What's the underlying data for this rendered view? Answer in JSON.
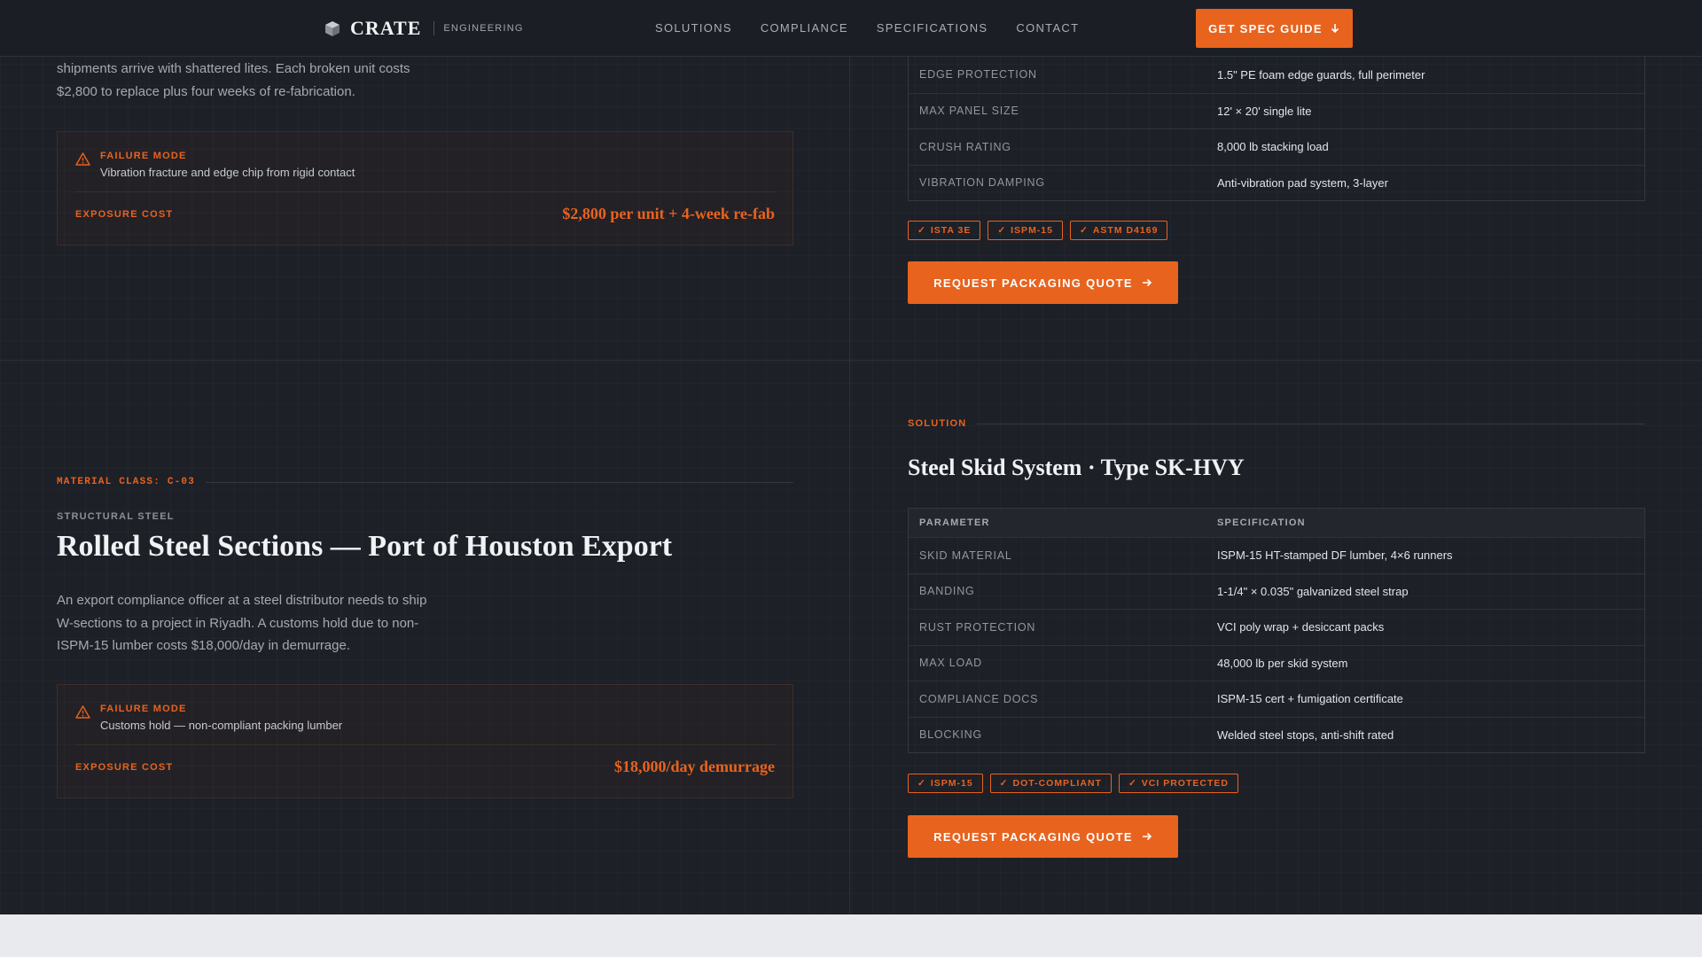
{
  "header": {
    "logo_text": "CRATE",
    "logo_sub": "ENGINEERING",
    "nav": [
      "SOLUTIONS",
      "COMPLIANCE",
      "SPECIFICATIONS",
      "CONTACT"
    ],
    "cta": "GET SPEC GUIDE",
    "cta_icon": "arrow-down-icon"
  },
  "case1": {
    "para": "shipments arrive with shattered lites. Each broken unit costs $2,800 to replace plus four weeks of re-fabrication.",
    "failure_label": "FAILURE MODE",
    "failure_text": "Vibration fracture and edge chip from rigid contact",
    "exposure_label": "EXPOSURE COST",
    "exposure_value": "$2,800 per unit + 4-week re-fab",
    "specs": [
      {
        "k": "EDGE PROTECTION",
        "v": "1.5\" PE foam edge guards, full perimeter"
      },
      {
        "k": "MAX PANEL SIZE",
        "v": "12' × 20' single lite"
      },
      {
        "k": "CRUSH RATING",
        "v": "8,000 lb stacking load"
      },
      {
        "k": "VIBRATION DAMPING",
        "v": "Anti-vibration pad system, 3-layer"
      }
    ],
    "badges": [
      "ISTA 3E",
      "ISPM-15",
      "ASTM D4169"
    ],
    "cta": "REQUEST PACKAGING QUOTE"
  },
  "case2": {
    "material_class": "MATERIAL CLASS: C-03",
    "eyebrow": "STRUCTURAL STEEL",
    "title": "Rolled Steel Sections — Port of Houston Export",
    "para": "An export compliance officer at a steel distributor needs to ship W-sections to a project in Riyadh. A customs hold due to non-ISPM-15 lumber costs $18,000/day in demurrage.",
    "failure_label": "FAILURE MODE",
    "failure_text": "Customs hold — non-compliant packing lumber",
    "exposure_label": "EXPOSURE COST",
    "exposure_value": "$18,000/day demurrage",
    "solution_label": "SOLUTION",
    "solution_title": "Steel Skid System · Type SK-HVY",
    "table_head": {
      "k": "PARAMETER",
      "v": "SPECIFICATION"
    },
    "specs": [
      {
        "k": "SKID MATERIAL",
        "v": "ISPM-15 HT-stamped DF lumber, 4×6 runners"
      },
      {
        "k": "BANDING",
        "v": "1-1/4\" × 0.035\" galvanized steel strap"
      },
      {
        "k": "RUST PROTECTION",
        "v": "VCI poly wrap + desiccant packs"
      },
      {
        "k": "MAX LOAD",
        "v": "48,000 lb per skid system"
      },
      {
        "k": "COMPLIANCE DOCS",
        "v": "ISPM-15 cert + fumigation certificate"
      },
      {
        "k": "BLOCKING",
        "v": "Welded steel stops, anti-shift rated"
      }
    ],
    "badges": [
      "ISPM-15",
      "DOT-COMPLIANT",
      "VCI PROTECTED"
    ],
    "cta": "REQUEST PACKAGING QUOTE"
  },
  "colors": {
    "accent": "#e8631e",
    "background": "#1d2027",
    "footer_band": "#e8eaed"
  }
}
